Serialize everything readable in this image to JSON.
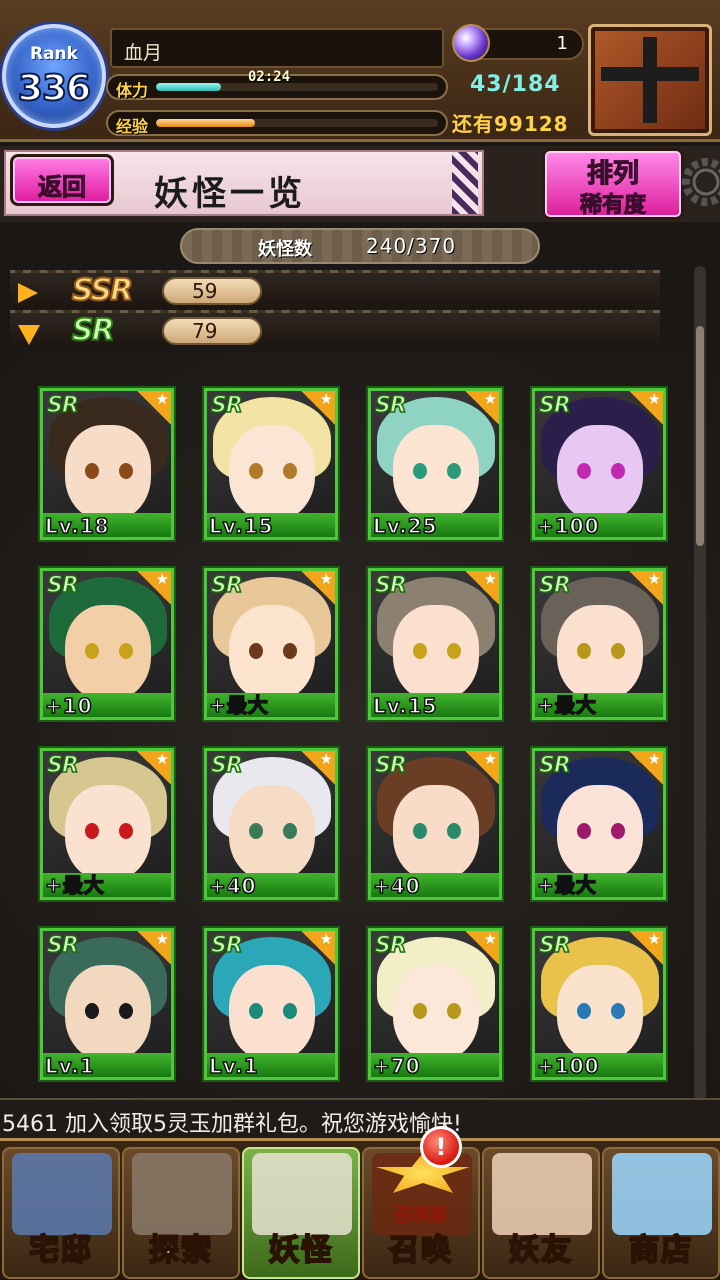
{
  "header": {
    "rank_label": "Rank",
    "rank_value": "336",
    "player_name": "血月",
    "stamina_label": "体力",
    "stamina_timer": "02:24",
    "stamina_fraction": 0.23,
    "stamina_count": "43/184",
    "exp_label": "经验",
    "exp_fraction": 0.35,
    "exp_remaining": "还有99128",
    "gem_count": "1"
  },
  "title_bar": {
    "back_label": "返回",
    "page_title": "妖怪一览",
    "sort_label": "排列",
    "sort_value": "稀有度"
  },
  "summary": {
    "count_label": "妖怪数",
    "count_value": "240/370"
  },
  "rarity_rows": [
    {
      "badge": "SSR",
      "count": "59",
      "expanded": false
    },
    {
      "badge": "SR",
      "count": "79",
      "expanded": true
    }
  ],
  "cards": [
    {
      "rarity": "SR",
      "level": "Lv.18",
      "hair": "#3a2a1e",
      "skin": "#f7dcc8",
      "eye": "#8a4a1a"
    },
    {
      "rarity": "SR",
      "level": "Lv.15",
      "hair": "#f2e2a4",
      "skin": "#fbe6d6",
      "eye": "#b07a2a"
    },
    {
      "rarity": "SR",
      "level": "Lv.25",
      "hair": "#8fd3c2",
      "skin": "#fbe4d2",
      "eye": "#2a9a7a"
    },
    {
      "rarity": "SR",
      "level": "+100",
      "hair": "#2a1f4a",
      "skin": "#e8c8f2",
      "eye": "#c02ab0"
    },
    {
      "rarity": "SR",
      "level": "+10",
      "hair": "#1f6a3a",
      "skin": "#f3cfa8",
      "eye": "#c8a21a"
    },
    {
      "rarity": "SR",
      "level": "+最大",
      "hair": "#e8c898",
      "skin": "#fbe3cd",
      "eye": "#6a3a1a"
    },
    {
      "rarity": "SR",
      "level": "Lv.15",
      "hair": "#8c8070",
      "skin": "#fbe0d0",
      "eye": "#c8a21a"
    },
    {
      "rarity": "SR",
      "level": "+最大",
      "hair": "#6a6258",
      "skin": "#fbe0d0",
      "eye": "#b8981a"
    },
    {
      "rarity": "SR",
      "level": "+最大",
      "hair": "#d6c690",
      "skin": "#fbe2d0",
      "eye": "#c81a1a"
    },
    {
      "rarity": "SR",
      "level": "+40",
      "hair": "#e8e8ee",
      "skin": "#f6dcc4",
      "eye": "#3a7a5a"
    },
    {
      "rarity": "SR",
      "level": "+40",
      "hair": "#6a3e24",
      "skin": "#f8dcc8",
      "eye": "#2a8a6a"
    },
    {
      "rarity": "SR",
      "level": "+最大",
      "hair": "#1a2a5a",
      "skin": "#fbe2d6",
      "eye": "#a01a6a"
    },
    {
      "rarity": "SR",
      "level": "Lv.1",
      "hair": "#3a6a5a",
      "skin": "#f3d8c0",
      "eye": "#1a1a1a"
    },
    {
      "rarity": "SR",
      "level": "Lv.1",
      "hair": "#2aa8b8",
      "skin": "#fbe0d0",
      "eye": "#1a8a7a"
    },
    {
      "rarity": "SR",
      "level": "+70",
      "hair": "#f2eec8",
      "skin": "#fbe8d8",
      "eye": "#b8981a"
    },
    {
      "rarity": "SR",
      "level": "+100",
      "hair": "#e8c24a",
      "skin": "#fbe2cc",
      "eye": "#2a7ab8"
    }
  ],
  "ticker": {
    "text": "5461   加入领取5灵玉加群礼包。祝您游戏愉快!"
  },
  "nav": {
    "items": [
      {
        "label": "宅邸",
        "icon": "mansion-icon",
        "color": "#5a7ab0"
      },
      {
        "label": "探索",
        "icon": "magnifier-icon",
        "color": "#8a7a6a"
      },
      {
        "label": "妖怪",
        "icon": "scroll-icon",
        "color": "#e8e2d0"
      },
      {
        "label": "召唤",
        "icon": "summon-star-icon",
        "color": "#6a2a12"
      },
      {
        "label": "妖友",
        "icon": "friend-girl-icon",
        "color": "#f0d2b8"
      },
      {
        "label": "商店",
        "icon": "crystal-orb-icon",
        "color": "#9ad8ff"
      }
    ],
    "summon_badge": "!",
    "summon_fest_label": "召唤祭"
  }
}
